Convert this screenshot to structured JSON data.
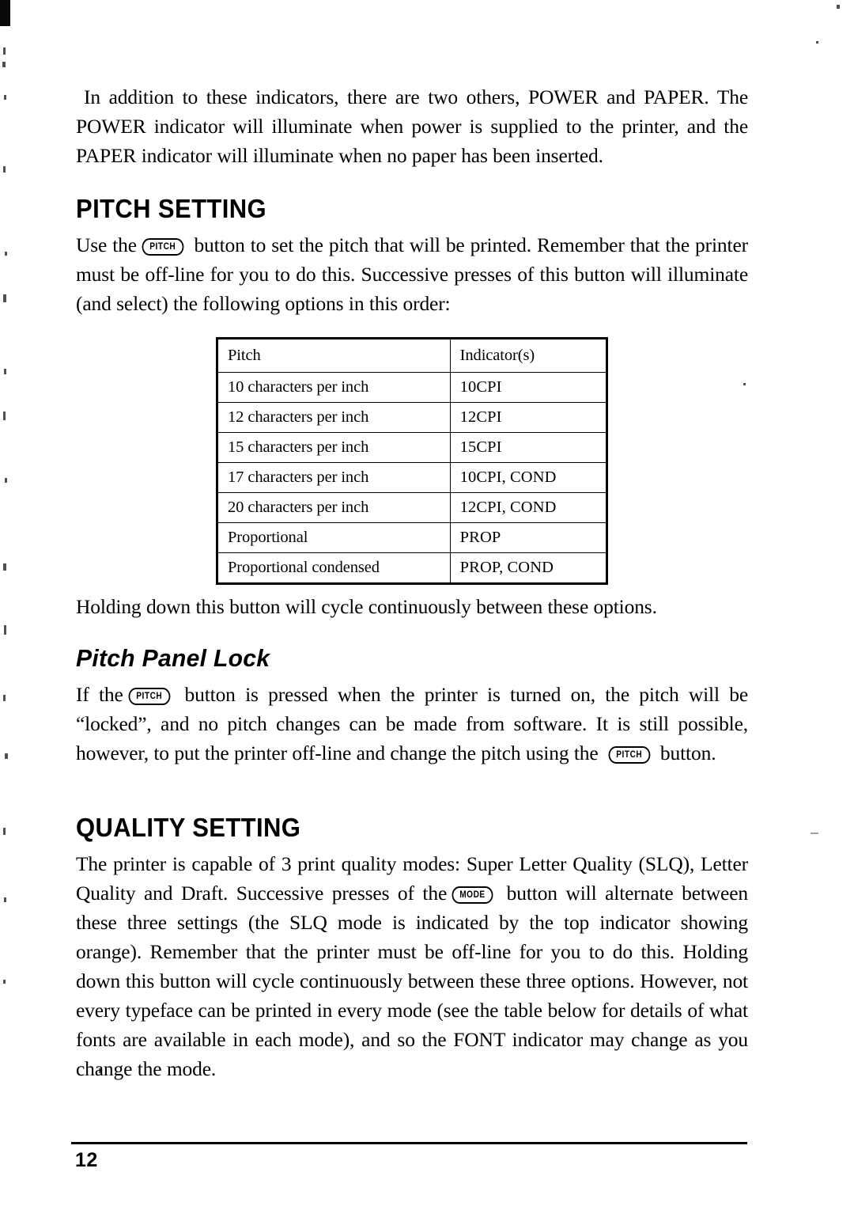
{
  "page": {
    "number": "12",
    "keys": {
      "pitch": "PITCH",
      "mode": "MODE"
    }
  },
  "intro": {
    "part1": "In addition to these indicators, there are two others, POWER and PAPER. The POWER indicator will illuminate when power is supplied to the printer, and the PAPER indicator will illuminate when no paper has been inserted."
  },
  "pitch_setting": {
    "heading": "PITCH SETTING",
    "para_before_key": "Use the",
    "para_after_key": "button to set the pitch that will be printed. Remember that the printer must be off-line for you to do this. Successive presses of this button will illuminate (and select) the following options in this order:",
    "table": {
      "columns": [
        "Pitch",
        "Indicator(s)"
      ],
      "rows": [
        [
          "10 characters per inch",
          "10CPI"
        ],
        [
          "12 characters per inch",
          "12CPI"
        ],
        [
          "15 characters per inch",
          "15CPI"
        ],
        [
          "17 characters per inch",
          "10CPI, COND"
        ],
        [
          "20 characters per inch",
          "12CPI, COND"
        ],
        [
          "Proportional",
          "PROP"
        ],
        [
          "Proportional condensed",
          "PROP, COND"
        ]
      ]
    },
    "after_table": "Holding down this button will cycle continuously between these options."
  },
  "pitch_panel_lock": {
    "heading": "Pitch Panel Lock",
    "para_before_key": "If the",
    "para_mid": "button is pressed when the printer is turned on, the pitch will be “locked”, and no pitch changes can be made from software. It is still possible, however, to put the printer off-line and change the pitch using the",
    "para_end": "button."
  },
  "quality_setting": {
    "heading": "QUALITY SETTING",
    "para_before_key": "The printer is capable of 3 print quality modes: Super Letter Quality (SLQ), Letter Quality and Draft. Successive presses of the",
    "para_after_key": "button will alternate between these three settings (the SLQ mode is indicated by the top indicator showing orange). Remember that the printer must be off-line for you to do this. Holding down this button will cycle continuously between these three options. However, not every typeface can be printed in every mode (see the table below for details of what fonts are available in each mode), and so the FONT indicator may change as you change the mode."
  }
}
